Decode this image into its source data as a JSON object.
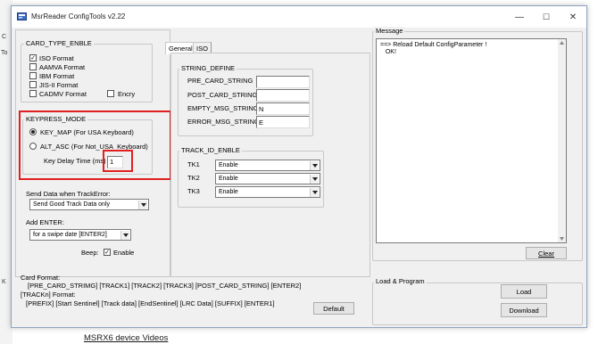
{
  "background": {
    "left_fragments": [
      "C",
      "To",
      "K"
    ],
    "link": "MSRX6 device Videos"
  },
  "window": {
    "title": "MsrReader ConfigTools v2.22",
    "controls": {
      "minimize": "—",
      "maximize": "☐",
      "close": "✕"
    }
  },
  "card_type": {
    "label": "CARD_TYPE_ENBLE",
    "options": [
      {
        "label": "ISO Format",
        "checked": true
      },
      {
        "label": "AAMVA Format",
        "checked": false
      },
      {
        "label": "IBM Format",
        "checked": false
      },
      {
        "label": "JIS-II Format",
        "checked": false
      },
      {
        "label": "CADMV Format",
        "checked": false
      }
    ],
    "encry_label": "Encry",
    "encry_checked": false
  },
  "keypress": {
    "label": "KEYPRESS_MODE",
    "options": [
      {
        "label": "KEY_MAP (For USA Keyboard)",
        "selected": true
      },
      {
        "label": "ALT_ASC (For Not_USA_Keyboard)",
        "selected": false
      }
    ],
    "delay_label": "Key  Delay Time (ms)",
    "delay_value": "1"
  },
  "send_data": {
    "label": "Send Data when TrackError:",
    "value": "Send Good Track Data only"
  },
  "add_enter": {
    "label": "Add ENTER:",
    "value": "for a swipe date [ENTER2]"
  },
  "beep": {
    "label": "Beep:",
    "checkbox_label": "Enable",
    "checked": true
  },
  "tabs": [
    "General",
    "ISO"
  ],
  "string_define": {
    "label": "STRING_DEFINE",
    "fields": [
      {
        "label": "PRE_CARD_STRING",
        "value": ""
      },
      {
        "label": "POST_CARD_STRING",
        "value": ""
      },
      {
        "label": "EMPTY_MSG_STRING",
        "value": "N"
      },
      {
        "label": "ERROR_MSG_STRING",
        "value": "E"
      }
    ]
  },
  "track_id": {
    "label": "TRACK_ID_ENBLE",
    "tracks": [
      {
        "label": "TK1",
        "value": "Enable"
      },
      {
        "label": "TK2",
        "value": "Enable"
      },
      {
        "label": "TK3",
        "value": "Enable"
      }
    ]
  },
  "formats": {
    "card_format_label": "Card Format:",
    "card_format_value": "[PRE_CARD_STRIMG] [TRACK1] [TRACK2] [TRACK3] [POST_CARD_STRING] [ENTER2]",
    "trackn_format_label": "[TRACKn] Format:",
    "trackn_format_value": "[PREFIX] [Start Sentinel] [Track data] [EndSentinel] [LRC Data] [SUFFIX] [ENTER1]"
  },
  "default_button": "Default",
  "message": {
    "label": "Message",
    "text": "==> Reload Default ConfigParameter !\n   OK!",
    "clear_button": "Clear"
  },
  "load_program": {
    "label": "Load & Program",
    "load_button": "Load",
    "download_button": "Download"
  },
  "colors": {
    "highlight": "#e02020",
    "window_bg": "#f0f0f0"
  }
}
